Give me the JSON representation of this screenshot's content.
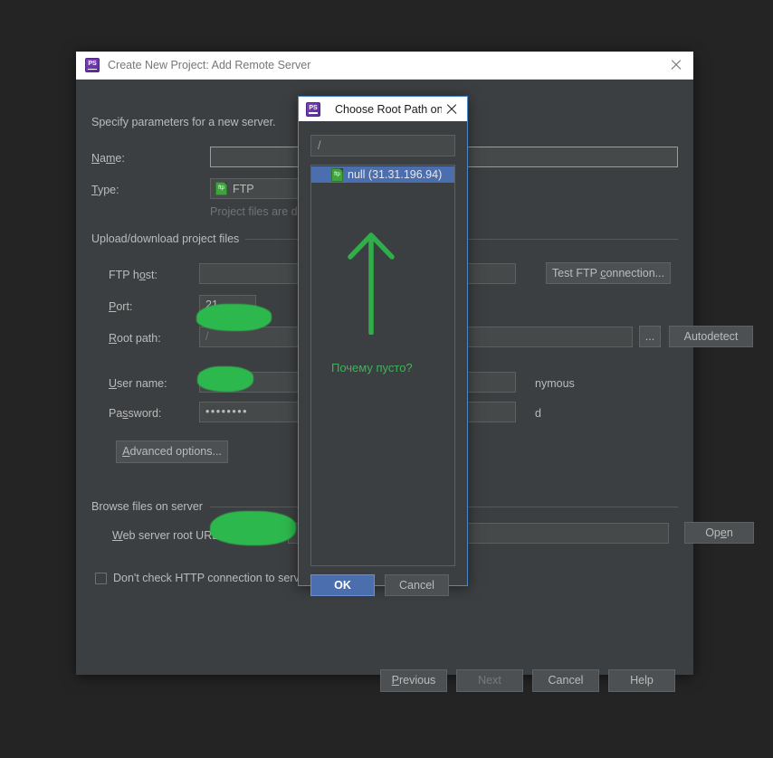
{
  "desktop": {
    "background": "#242424"
  },
  "main_dialog": {
    "title": "Create New Project: Add Remote Server",
    "logo_name": "phpstorm-logo",
    "intro": "Specify parameters for a new server.",
    "fields": {
      "name_label": "Name:",
      "name_value": "",
      "type_label": "Type:",
      "type_value": "FTP",
      "type_hint": "Project files are deployed to a remote",
      "upload_section": "Upload/download project files",
      "ftp_host_label": "FTP host:",
      "ftp_host_value": "",
      "port_label": "Port:",
      "port_value": "21",
      "root_path_label": "Root path:",
      "root_path_value": "/",
      "user_name_label": "User name:",
      "user_name_value": "",
      "password_label": "Password:",
      "password_value": "••••••••",
      "anonymous_partial": "nymous",
      "save_password_partial": "d",
      "browse_section": "Browse files on server",
      "web_root_label": "Web server root URL:",
      "web_root_value": "",
      "dont_check_label": "Don't check HTTP connection to server"
    },
    "buttons": {
      "test_ftp": "Test FTP connection...",
      "browse_dots": "...",
      "autodetect": "Autodetect",
      "advanced": "Advanced options...",
      "open": "Open"
    },
    "wizard_buttons": [
      {
        "label": "Previous",
        "disabled": false
      },
      {
        "label": "Next",
        "disabled": true
      },
      {
        "label": "Cancel",
        "disabled": false
      },
      {
        "label": "Help",
        "disabled": false
      }
    ]
  },
  "modal": {
    "title": "Choose Root Path on ...",
    "logo_name": "phpstorm-logo",
    "path_value": "/",
    "tree_items": [
      {
        "label": "null (31.31.196.94)",
        "icon": "ftp-icon",
        "selected": true
      }
    ],
    "ok_label": "OK",
    "cancel_label": "Cancel"
  },
  "annotation": {
    "text": "Почему пусто?",
    "color": "#3fb25a",
    "arrow_direction": "up"
  }
}
